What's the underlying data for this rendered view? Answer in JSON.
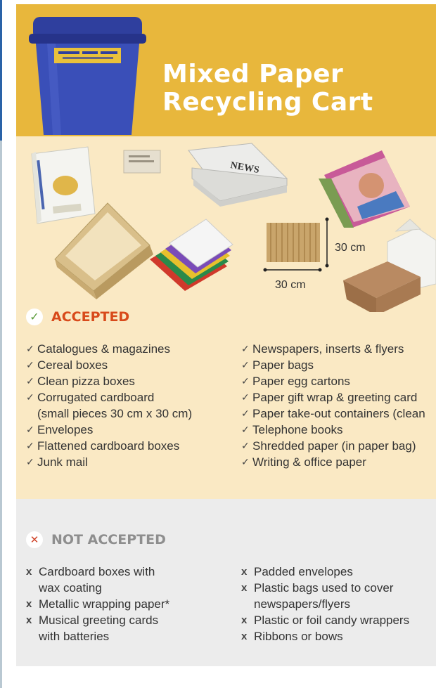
{
  "header": {
    "title_line1": "Mixed Paper",
    "title_line2": "Recycling Cart",
    "colors": {
      "header_bg": "#e8b73c",
      "accepted_bg": "#fae9c4",
      "not_accepted_bg": "#ececec",
      "accepted_heading": "#d84a1b"
    }
  },
  "photos": {
    "newspaper_label": "NEWS",
    "dimension_height": "30 cm",
    "dimension_width": "30 cm"
  },
  "accepted": {
    "heading": "ACCEPTED",
    "icon": "check-icon",
    "left": [
      {
        "line1": "Catalogues & magazines"
      },
      {
        "line1": "Cereal boxes"
      },
      {
        "line1": "Clean pizza boxes"
      },
      {
        "line1": "Corrugated cardboard",
        "line2": "(small pieces 30 cm x 30 cm)"
      },
      {
        "line1": "Envelopes"
      },
      {
        "line1": "Flattened cardboard boxes"
      },
      {
        "line1": "Junk mail"
      }
    ],
    "right": [
      {
        "line1": "Newspapers, inserts & flyers"
      },
      {
        "line1": "Paper bags"
      },
      {
        "line1": "Paper egg cartons"
      },
      {
        "line1": "Paper gift wrap & greeting card"
      },
      {
        "line1": "Paper take-out containers (clean"
      },
      {
        "line1": "Telephone books"
      },
      {
        "line1": "Shredded paper (in paper bag)"
      },
      {
        "line1": "Writing & office paper"
      }
    ]
  },
  "not_accepted": {
    "heading": "NOT ACCEPTED",
    "icon": "cross-icon",
    "left": [
      {
        "line1": "Cardboard boxes with",
        "line2": "wax coating"
      },
      {
        "line1": "Metallic wrapping paper*"
      },
      {
        "line1": "Musical greeting cards",
        "line2": "with batteries"
      }
    ],
    "right": [
      {
        "line1": "Padded envelopes"
      },
      {
        "line1": "Plastic bags used to cover",
        "line2": "newspapers/flyers"
      },
      {
        "line1": "Plastic or foil candy wrappers"
      },
      {
        "line1": "Ribbons or bows"
      }
    ]
  }
}
